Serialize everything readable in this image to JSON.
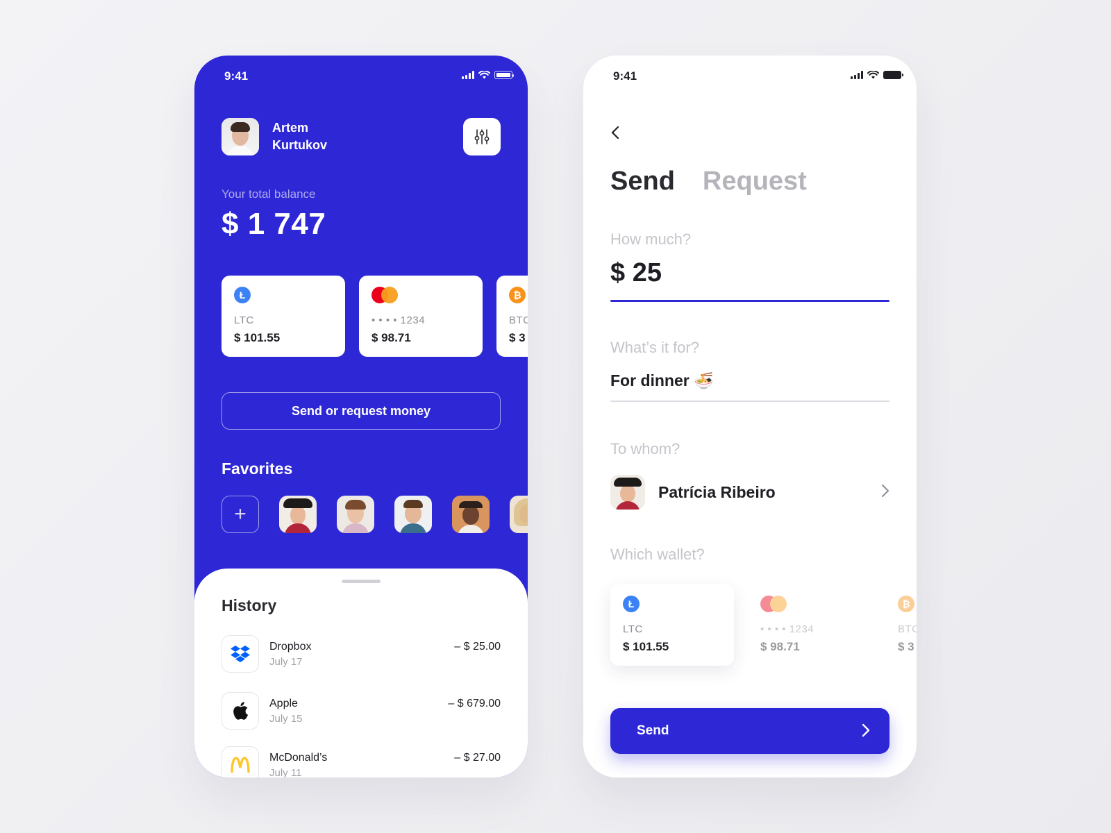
{
  "left_screen": {
    "status": {
      "time": "9:41"
    },
    "user": {
      "first_name": "Artem",
      "last_name": "Kurtukov"
    },
    "balance_label": "Your total balance",
    "balance": "$ 1 747",
    "cards": [
      {
        "icon": "litecoin-icon",
        "label": "LTC",
        "amount": "$ 101.55",
        "color": "#3b82f6"
      },
      {
        "icon": "mastercard-icon",
        "label": "• • • •  1234",
        "amount": "$ 98.71"
      },
      {
        "icon": "bitcoin-icon",
        "label": "BTC",
        "amount": "$ 3",
        "color": "#f7931a"
      }
    ],
    "send_request_label": "Send or request money",
    "favorites_title": "Favorites",
    "add_icon": "plus-icon",
    "history": {
      "title": "History",
      "items": [
        {
          "name": "Dropbox",
          "date": "July 17",
          "amount": "– $ 25.00",
          "icon": "dropbox-icon"
        },
        {
          "name": "Apple",
          "date": "July 15",
          "amount": "– $ 679.00",
          "icon": "apple-icon"
        },
        {
          "name": "McDonald’s",
          "date": "July 11",
          "amount": "– $ 27.00",
          "icon": "mcdonalds-icon"
        }
      ]
    }
  },
  "right_screen": {
    "status": {
      "time": "9:41"
    },
    "tabs": {
      "send": "Send",
      "request": "Request"
    },
    "amount_label": "How much?",
    "amount_value": "$ 25",
    "purpose_label": "What’s it for?",
    "purpose_value": "For dinner 🍜",
    "recipient_label": "To whom?",
    "recipient_name": "Patrícia Ribeiro",
    "wallet_label": "Which wallet?",
    "wallets": [
      {
        "label": "LTC",
        "amount": "$ 101.55"
      },
      {
        "label": "• • • •  1234",
        "amount": "$ 98.71"
      },
      {
        "label": "BTC",
        "amount": "$ 3"
      }
    ],
    "send_button": "Send"
  },
  "colors": {
    "primary": "#2d27d6",
    "litecoin": "#3b82f6",
    "bitcoin": "#f7931a",
    "mastercard_red": "#eb001b",
    "mastercard_orange": "#f79e1b"
  }
}
